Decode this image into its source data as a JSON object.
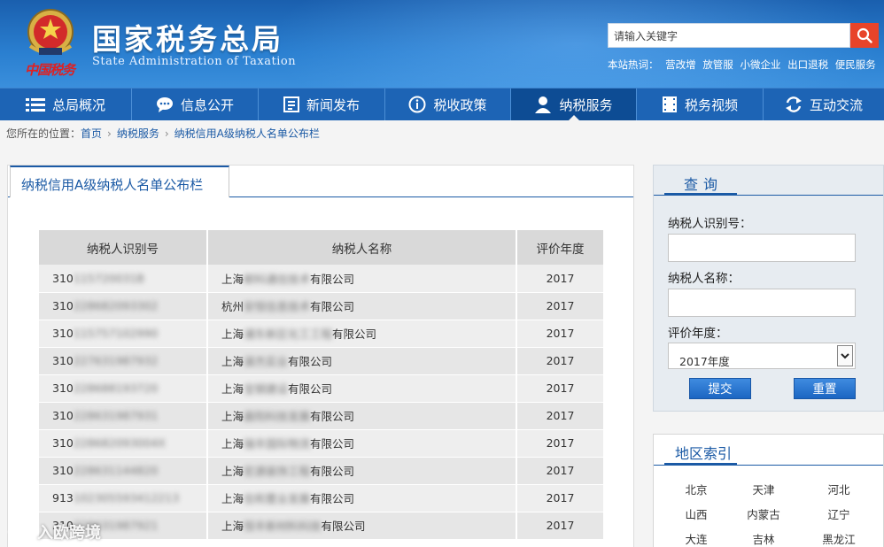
{
  "header": {
    "logo_sub": "中国税务",
    "title": "国家税务总局",
    "subtitle": "State Administration of Taxation",
    "search_placeholder": "请输入关键字",
    "hot_label": "本站热词：",
    "hot_words": [
      "营改增",
      "放管服",
      "小微企业",
      "出口退税",
      "便民服务"
    ]
  },
  "nav": [
    {
      "label": "总局概况",
      "icon": "menu-icon"
    },
    {
      "label": "信息公开",
      "icon": "chat-icon"
    },
    {
      "label": "新闻发布",
      "icon": "document-icon"
    },
    {
      "label": "税收政策",
      "icon": "info-icon"
    },
    {
      "label": "纳税服务",
      "icon": "user-icon",
      "active": true
    },
    {
      "label": "税务视频",
      "icon": "film-icon"
    },
    {
      "label": "互动交流",
      "icon": "exchange-icon"
    }
  ],
  "breadcrumb": {
    "prefix": "您所在的位置：",
    "items": [
      "首页",
      "纳税服务",
      "纳税信用A级纳税人名单公布栏"
    ]
  },
  "main": {
    "tab": "纳税信用A级纳税人名单公布栏",
    "columns": [
      "纳税人识别号",
      "纳税人名称",
      "评价年度"
    ],
    "rows": [
      {
        "id": "310115720031B",
        "name": "上海邮科通信技术有限公司",
        "year": "2017"
      },
      {
        "id": "310228682093302",
        "name": "杭州安恒信息技术有限公司",
        "year": "2017"
      },
      {
        "id": "310115757102990",
        "name": "上海浦东新区化工工程有限公司",
        "year": "2017"
      },
      {
        "id": "310227631987932",
        "name": "上海谋杰实业有限公司",
        "year": "2017"
      },
      {
        "id": "310228688193720",
        "name": "上海宝钢建设有限公司",
        "year": "2017"
      },
      {
        "id": "310228631987931",
        "name": "上海晨阳科技发展有限公司",
        "year": "2017"
      },
      {
        "id": "310228682093004X",
        "name": "上海瑞丰国际物流有限公司",
        "year": "2017"
      },
      {
        "id": "310228631144820",
        "name": "上海宏源装饰工程有限公司",
        "year": "2017"
      },
      {
        "id": "913102305593412213",
        "name": "上海信和置业发展有限公司",
        "year": "2017"
      },
      {
        "id": "310228631987921",
        "name": "上海恒丰新材料科技有限公司",
        "year": "2017"
      }
    ]
  },
  "query": {
    "title": "查询",
    "id_label": "纳税人识别号：",
    "name_label": "纳税人名称：",
    "year_label": "评价年度：",
    "year_value": "2017年度",
    "submit": "提交",
    "reset": "重置"
  },
  "region": {
    "title": "地区索引",
    "items": [
      "北京",
      "天津",
      "河北",
      "山西",
      "内蒙古",
      "辽宁",
      "大连",
      "吉林",
      "黑龙江"
    ]
  },
  "watermark": "入欧跨境",
  "colors": {
    "primary": "#1d64b5",
    "accent": "#e8442a",
    "header_light": "#3a8fdc"
  }
}
